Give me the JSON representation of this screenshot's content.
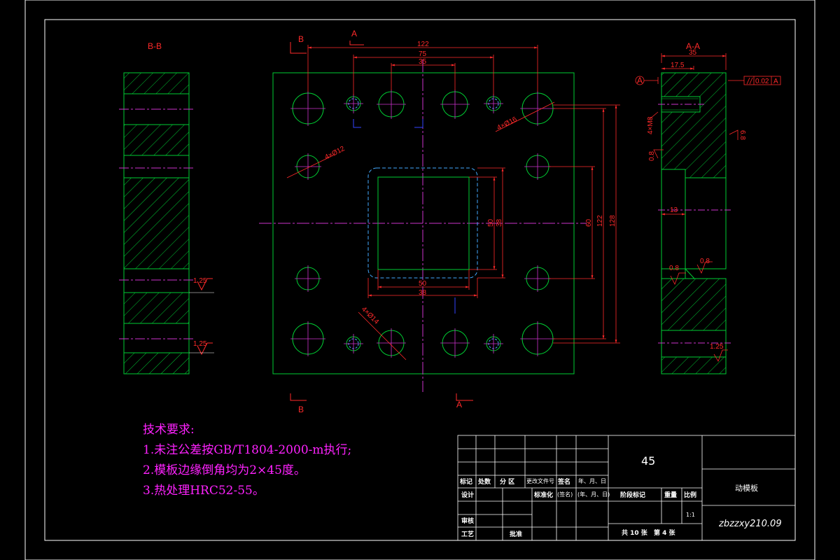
{
  "section_labels": {
    "bb_title": "B-B",
    "aa_title": "A-A",
    "cut_b": "B",
    "cut_a": "A",
    "datum": "A"
  },
  "dimensions": {
    "top_122": "122",
    "top_75": "75",
    "top_35": "35",
    "r_128": "128",
    "r_122": "122",
    "r_60": "60",
    "c_50v": "50",
    "c_38v": "38",
    "c_50h": "50",
    "c_38h": "38",
    "hole_4x16": "4×Ø16",
    "hole_4x12": "4×Ø12",
    "hole_4x14": "4×Ø14",
    "aa_35": "35",
    "aa_17_5": "17.5",
    "aa_13": "13",
    "aa_4xm8": "4×M8",
    "tol": "0.02",
    "tol_datum": "A"
  },
  "roughness": {
    "bb_1": "1.25",
    "bb_2": "1.25",
    "aa_6_8": "6.8",
    "aa_0_8a": "0.8",
    "aa_0_8b": "0.8",
    "aa_0_8c": "0.8",
    "aa_1_25": "1.25"
  },
  "requirements": {
    "title": "技术要求:",
    "line1": "1.未注公差按GB/T1804-2000-m执行;",
    "line2": "2.模板边缘倒角均为2×45度。",
    "line3": "3.热处理HRC52-55。"
  },
  "title_block": {
    "material": "45",
    "part_name": "动模板",
    "drawing_no": "zbzzxy210.09",
    "scale": "1:1",
    "sheets": "共 10 张",
    "sheet_no": "第 4 张",
    "h_mark": "标记",
    "h_count": "处数",
    "h_zone": "分 区",
    "h_docno": "更改文件号",
    "h_sign": "签名",
    "h_date": "年、月、日",
    "h_design": "设计",
    "h_std": "标准化",
    "h_sign2": "(签名)",
    "h_date2": "(年、月、日)",
    "h_stage": "阶段标记",
    "h_weight": "重量",
    "h_ratio": "比例",
    "h_review": "审核",
    "h_process": "工艺",
    "h_approve": "批准"
  },
  "colors": {
    "background": "#000000",
    "outline": "#00cc33",
    "dimension": "#ff2a2a",
    "centerline": "#cc33cc",
    "hidden": "#44aaff",
    "text_requirements": "#ff22ff",
    "frame": "#ffffff"
  }
}
